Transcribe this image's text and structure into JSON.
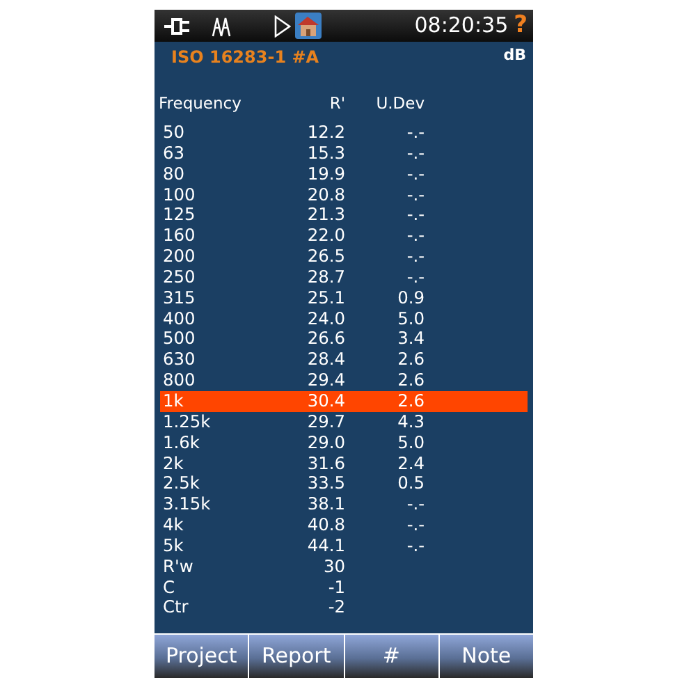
{
  "status_bar": {
    "time": "08:20:35",
    "help": "?"
  },
  "title": "ISO 16283-1 #A",
  "unit": "dB",
  "table": {
    "columns": [
      "Frequency",
      "R'",
      "U.Dev"
    ],
    "rows": [
      {
        "cells": [
          "50",
          "12.2",
          "-.-"
        ],
        "selected": false
      },
      {
        "cells": [
          "63",
          "15.3",
          "-.-"
        ],
        "selected": false
      },
      {
        "cells": [
          "80",
          "19.9",
          "-.-"
        ],
        "selected": false
      },
      {
        "cells": [
          "100",
          "20.8",
          "-.-"
        ],
        "selected": false
      },
      {
        "cells": [
          "125",
          "21.3",
          "-.-"
        ],
        "selected": false
      },
      {
        "cells": [
          "160",
          "22.0",
          "-.-"
        ],
        "selected": false
      },
      {
        "cells": [
          "200",
          "26.5",
          "-.-"
        ],
        "selected": false
      },
      {
        "cells": [
          "250",
          "28.7",
          "-.-"
        ],
        "selected": false
      },
      {
        "cells": [
          "315",
          "25.1",
          "0.9"
        ],
        "selected": false
      },
      {
        "cells": [
          "400",
          "24.0",
          "5.0"
        ],
        "selected": false
      },
      {
        "cells": [
          "500",
          "26.6",
          "3.4"
        ],
        "selected": false
      },
      {
        "cells": [
          "630",
          "28.4",
          "2.6"
        ],
        "selected": false
      },
      {
        "cells": [
          "800",
          "29.4",
          "2.6"
        ],
        "selected": false
      },
      {
        "cells": [
          "1k",
          "30.4",
          "2.6"
        ],
        "selected": true
      },
      {
        "cells": [
          "1.25k",
          "29.7",
          "4.3"
        ],
        "selected": false
      },
      {
        "cells": [
          "1.6k",
          "29.0",
          "5.0"
        ],
        "selected": false
      },
      {
        "cells": [
          "2k",
          "31.6",
          "2.4"
        ],
        "selected": false
      },
      {
        "cells": [
          "2.5k",
          "33.5",
          "0.5"
        ],
        "selected": false
      },
      {
        "cells": [
          "3.15k",
          "38.1",
          "-.-"
        ],
        "selected": false
      },
      {
        "cells": [
          "4k",
          "40.8",
          "-.-"
        ],
        "selected": false
      },
      {
        "cells": [
          "5k",
          "44.1",
          "-.-"
        ],
        "selected": false
      },
      {
        "cells": [
          "R'w",
          "30"
        ],
        "selected": false
      },
      {
        "cells": [
          "C",
          "-1"
        ],
        "selected": false
      },
      {
        "cells": [
          "Ctr",
          "-2"
        ],
        "selected": false
      }
    ]
  },
  "buttons": [
    "Project",
    "Report",
    "#",
    "Note"
  ]
}
